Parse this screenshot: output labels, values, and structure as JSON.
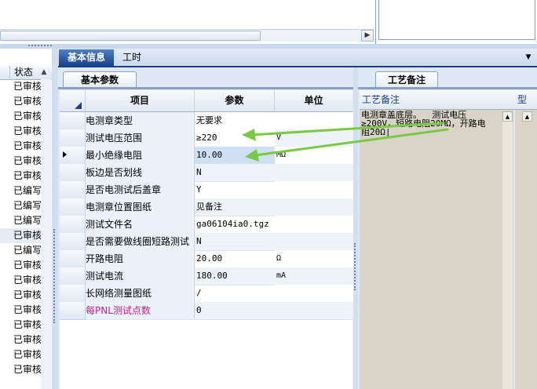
{
  "left_list": {
    "header": "状态",
    "rows": [
      "已审核",
      "已审核",
      "已审核",
      "已审核",
      "已审核",
      "已审核",
      "已审核",
      "已编写",
      "已编写",
      "已编写",
      "已审核",
      "已编写",
      "已审核",
      "已审核",
      "已审核",
      "已审核",
      "已审核",
      "已审核",
      "已审核",
      "已审核"
    ],
    "selected_index": 10
  },
  "tabs": {
    "basic_info": "基本信息",
    "work_hours": "工时"
  },
  "basic_params": {
    "tab_label": "基本参数",
    "columns": [
      "项目",
      "参数",
      "单位"
    ],
    "rows": [
      {
        "item": "电测章类型",
        "value": "无要求",
        "unit": ""
      },
      {
        "item": "测试电压范围",
        "value": "≥220",
        "unit": "V"
      },
      {
        "item": "最小绝缘电阻",
        "value": "10.00",
        "unit": "MΩ"
      },
      {
        "item": "板边是否划线",
        "value": "N",
        "unit": ""
      },
      {
        "item": "是否电测试后盖章",
        "value": "Y",
        "unit": ""
      },
      {
        "item": "电测章位置图纸",
        "value": "见备注",
        "unit": ""
      },
      {
        "item": "测试文件名",
        "value": "ga06104ia0.tgz",
        "unit": ""
      },
      {
        "item": "是否需要做线圈短路测试",
        "value": "N",
        "unit": ""
      },
      {
        "item": "开路电阻",
        "value": "20.00",
        "unit": "Ω"
      },
      {
        "item": "测试电流",
        "value": "180.00",
        "unit": "mA"
      },
      {
        "item": "长网络测量图纸",
        "value": "/",
        "unit": ""
      },
      {
        "item": "每PNL测试点数",
        "value": "0",
        "unit": ""
      }
    ]
  },
  "process_notes": {
    "tab_label": "工艺备注",
    "column_label": "工艺备注",
    "column2_label": "型",
    "text": "电测章盖底层。  测试电压\n≥200V，短路电阻20MΩ，开路电\n阻20Ω|"
  },
  "colors": {
    "accent": "#15428b",
    "arrow": "#7ac943",
    "highlight_item": "#c0208a"
  }
}
